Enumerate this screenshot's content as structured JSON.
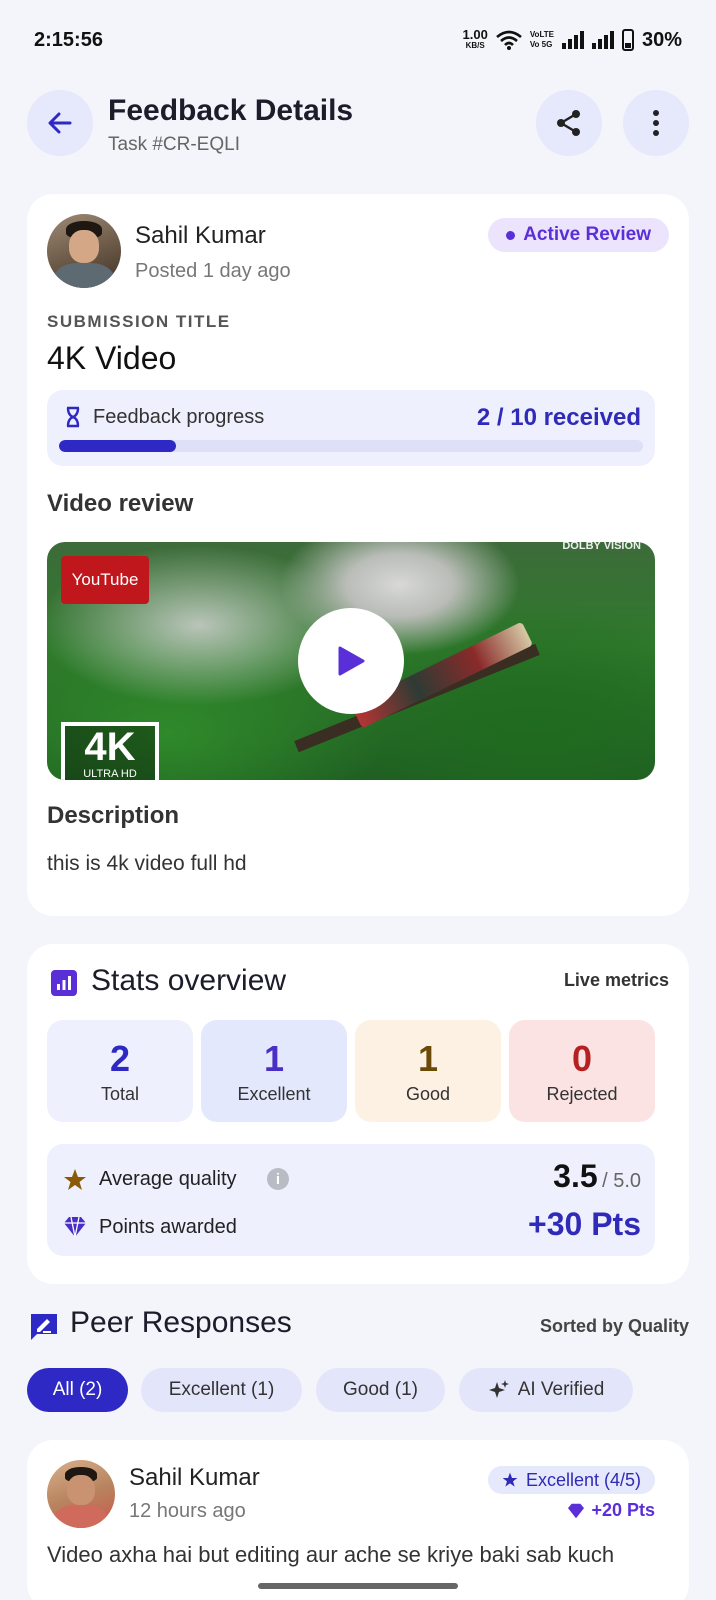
{
  "status_bar": {
    "time": "2:15:56",
    "net_speed_value": "1.00",
    "net_speed_unit": "KB/S",
    "volte_top": "VoLTE",
    "volte_bottom": "Vo 5G",
    "battery_pct": "30%"
  },
  "header": {
    "title": "Feedback Details",
    "subtitle": "Task #CR-EQLI"
  },
  "submission": {
    "author": "Sahil Kumar",
    "posted": "Posted 1 day ago",
    "status_badge": "Active Review",
    "section_label": "SUBMISSION TITLE",
    "title": "4K Video",
    "progress_label": "Feedback progress",
    "progress_text": "2 / 10 received",
    "progress_received": 2,
    "progress_total": 10,
    "video_heading": "Video review",
    "video_badge": "YouTube",
    "video_4k": "4K",
    "video_4k_sub": "ULTRA HD",
    "video_dolby": "DOLBY VISION",
    "description_heading": "Description",
    "description": "this is 4k video full hd"
  },
  "stats": {
    "title": "Stats overview",
    "live": "Live metrics",
    "tiles": [
      {
        "value": "2",
        "label": "Total"
      },
      {
        "value": "1",
        "label": "Excellent"
      },
      {
        "value": "1",
        "label": "Good"
      },
      {
        "value": "0",
        "label": "Rejected"
      }
    ],
    "avg_quality_label": "Average quality",
    "avg_quality_value": "3.5",
    "avg_quality_max": "/ 5.0",
    "points_label": "Points awarded",
    "points_value": "+30 Pts"
  },
  "peer": {
    "title": "Peer Responses",
    "sorted": "Sorted by Quality",
    "filters": [
      "All (2)",
      "Excellent (1)",
      "Good (1)",
      "AI Verified"
    ],
    "responses": [
      {
        "author": "Sahil Kumar",
        "time": "12 hours ago",
        "rating": "Excellent (4/5)",
        "points": "+20 Pts",
        "text": "Video axha hai but editing aur ache se kriye baki sab kuch"
      }
    ]
  },
  "colors": {
    "accent": "#2e28c4",
    "excellent_tile": "#e3e8fd",
    "good_tile": "#fdf1e4",
    "rejected_tile": "#fbe3e3",
    "total_tile": "#eef0fd"
  }
}
